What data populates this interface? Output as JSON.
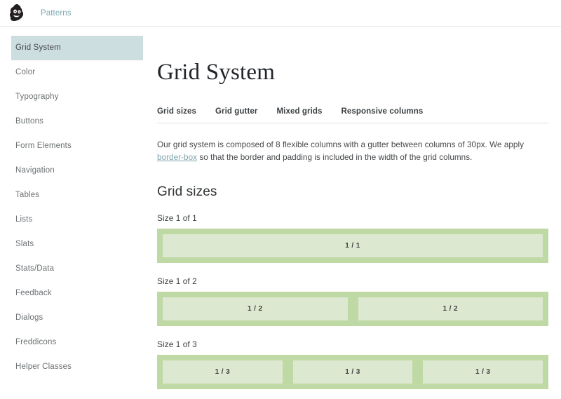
{
  "header": {
    "logo_icon": "mailchimp-freddie-icon",
    "link_label": "Patterns"
  },
  "sidebar": {
    "items": [
      {
        "label": "Grid System",
        "active": true
      },
      {
        "label": "Color",
        "active": false
      },
      {
        "label": "Typography",
        "active": false
      },
      {
        "label": "Buttons",
        "active": false
      },
      {
        "label": "Form Elements",
        "active": false
      },
      {
        "label": "Navigation",
        "active": false
      },
      {
        "label": "Tables",
        "active": false
      },
      {
        "label": "Lists",
        "active": false
      },
      {
        "label": "Slats",
        "active": false
      },
      {
        "label": "Stats/Data",
        "active": false
      },
      {
        "label": "Feedback",
        "active": false
      },
      {
        "label": "Dialogs",
        "active": false
      },
      {
        "label": "Freddicons",
        "active": false
      },
      {
        "label": "Helper Classes",
        "active": false
      }
    ]
  },
  "main": {
    "page_title": "Grid System",
    "tabs": [
      {
        "label": "Grid sizes"
      },
      {
        "label": "Grid gutter"
      },
      {
        "label": "Mixed grids"
      },
      {
        "label": "Responsive columns"
      }
    ],
    "intro": {
      "text_before": "Our grid system is composed of 8 flexible columns with a gutter between columns of 30px. We apply ",
      "link_label": "border-box",
      "text_after": " so that the border and padding is included in the width of the grid columns."
    },
    "section_title": "Grid sizes",
    "demos": [
      {
        "label": "Size 1 of 1",
        "cells": [
          "1 / 1"
        ]
      },
      {
        "label": "Size 1 of 2",
        "cells": [
          "1 / 2",
          "1 / 2"
        ]
      },
      {
        "label": "Size 1 of 3",
        "cells": [
          "1 / 3",
          "1 / 3",
          "1 / 3"
        ]
      }
    ]
  },
  "colors": {
    "accent_link": "#80a9b2",
    "sidebar_active_bg": "#ccdee0",
    "grid_wrapper_green": "#bfd9a5",
    "grid_cell_green": "#dce8cf"
  }
}
